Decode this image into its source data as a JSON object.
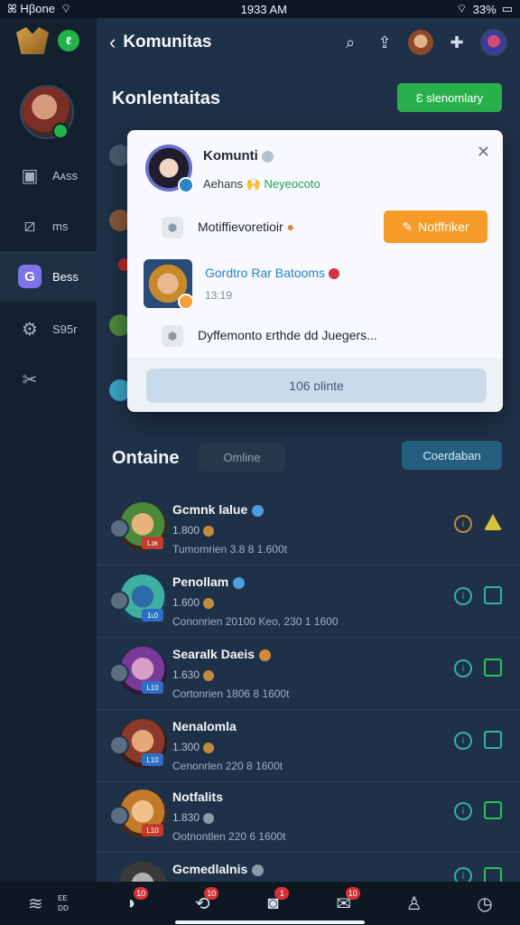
{
  "status_bar": {
    "carrier": "ꕤ Hβone",
    "time": "1933 AM",
    "battery": "33%"
  },
  "sidebar": {
    "items": [
      {
        "icon": "briefcase-icon",
        "label": "Aᴀss"
      },
      {
        "icon": "edit-box-icon",
        "label": "ms"
      },
      {
        "icon": "community-icon",
        "label": "Bess",
        "icon_glyph": "G"
      },
      {
        "icon": "gear-icon",
        "label": "S95r"
      },
      {
        "icon": "tools-icon",
        "label": ""
      }
    ]
  },
  "topbar": {
    "title": "Komunitas"
  },
  "main": {
    "section_title": "Konlentaitas",
    "green_button": "Ɛ slenomlary"
  },
  "modal": {
    "title": "Komunti",
    "sub_prefix": "Aehans",
    "sub_link": "Neyeocoto",
    "row1_text": "Motiffievoretioir",
    "orange_button": "Notffriker",
    "name2": "Gordtro Rar Batooms",
    "time2": "13:19",
    "row2_text": "Dyffemonto ᴇrthde dd Juegers...",
    "footer_button": "106 ᴅlinte"
  },
  "online": {
    "title": "Ontaine",
    "tab": "Omline",
    "button": "Coerdaban"
  },
  "list": [
    {
      "name": "Gcmnk lalue",
      "meta": "1.800",
      "detail": "Tumomrien 3.8 8 1.600t",
      "lvl": "Lɪʀ",
      "badge_color": "#4a9fe0"
    },
    {
      "name": "Penollam",
      "meta": "1.600",
      "detail": "Cononrien 20100 Keo, 230 1 1600",
      "lvl": "1ʟ0",
      "badge_color": "#4a9fe0"
    },
    {
      "name": "Searalk Daeis",
      "meta": "1.630",
      "detail": "Cortonrien 1806 8 1600t",
      "lvl": "L10",
      "badge_color": "#d08a3b"
    },
    {
      "name": "Nenalomla",
      "meta": "1.300",
      "detail": "Cenonrlen 220 8 1600t",
      "lvl": "L10",
      "badge_color": ""
    },
    {
      "name": "Notfalits",
      "meta": "1.830",
      "detail": "Ootnontlen 220 6 1600t",
      "lvl": "L10",
      "badge_color": ""
    },
    {
      "name": "Gcmedlalnis",
      "meta": "",
      "detail": "",
      "lvl": "",
      "badge_color": "#8a9aaa"
    }
  ],
  "bottom_nav": {
    "left_label": "ᴇᴇ\nᴅᴅ",
    "items": [
      {
        "icon": "cup-icon",
        "badge": "10"
      },
      {
        "icon": "sync-icon",
        "badge": "10"
      },
      {
        "icon": "camera-icon",
        "badge": "1"
      },
      {
        "icon": "mail-icon",
        "badge": "10"
      },
      {
        "icon": "person-icon",
        "badge": ""
      },
      {
        "icon": "clock-icon",
        "badge": ""
      }
    ]
  },
  "colors": {
    "accent_green": "#29b04c",
    "accent_orange": "#f59b27",
    "teal": "#24607d",
    "background": "#1f3148",
    "sidebar": "#13212f"
  }
}
